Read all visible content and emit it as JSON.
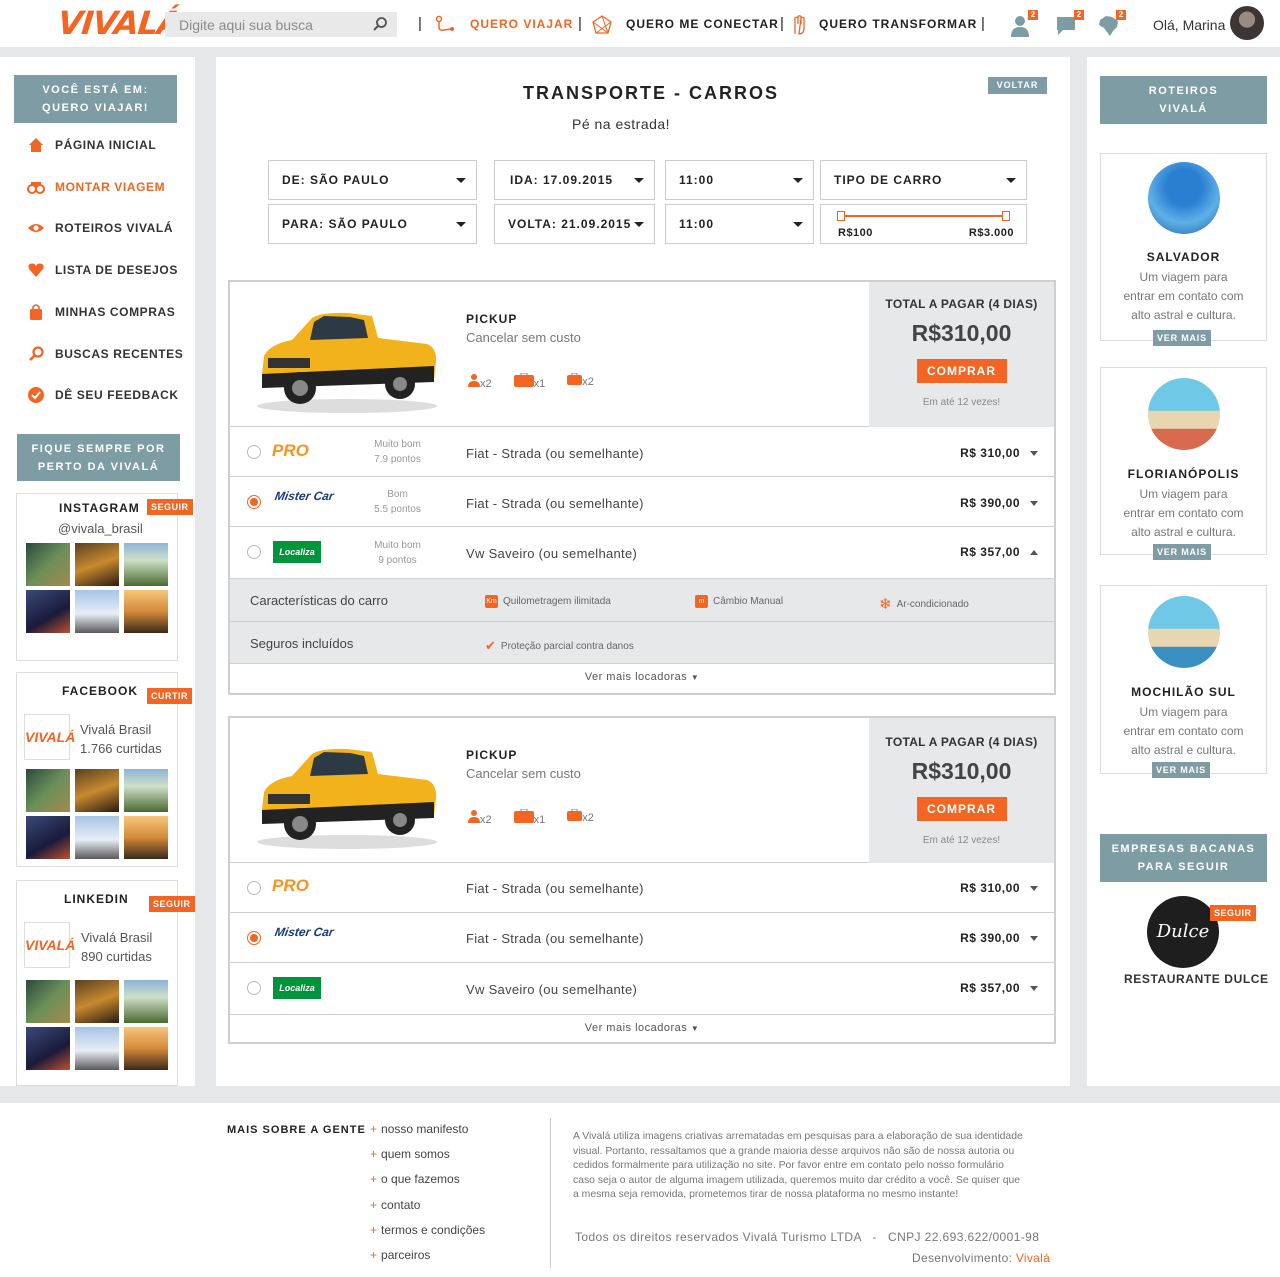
{
  "header": {
    "logo": "VIVALÁ",
    "search_placeholder": "Digite aqui sua busca",
    "nav": [
      "QUERO VIAJAR",
      "QUERO ME CONECTAR",
      "QUERO TRANSFORMAR"
    ],
    "badges": [
      "2",
      "2",
      "2"
    ],
    "greeting": "Olá, Marina"
  },
  "sidebar": {
    "you_are_in": "VOCÊ ESTÁ EM:",
    "you_are_in_sub": "QUERO VIAJAR!",
    "items": [
      {
        "label": "PÁGINA INICIAL",
        "icon": "home-icon"
      },
      {
        "label": "MONTAR VIAGEM",
        "icon": "binoculars-icon"
      },
      {
        "label": "ROTEIROS VIVALÁ",
        "icon": "eye-icon"
      },
      {
        "label": "LISTA DE DESEJOS",
        "icon": "heart-icon"
      },
      {
        "label": "MINHAS COMPRAS",
        "icon": "shopping-bag-icon"
      },
      {
        "label": "BUSCAS RECENTES",
        "icon": "magnifier-icon"
      },
      {
        "label": "DÊ SEU FEEDBACK",
        "icon": "check-icon"
      }
    ],
    "stay_close": "FIQUE SEMPRE POR",
    "stay_close_sub": "PERTO DA VIVALÁ",
    "instagram": {
      "title": "INSTAGRAM",
      "button": "SEGUIR",
      "handle": "@vivala_brasil"
    },
    "facebook": {
      "title": "FACEBOOK",
      "button": "CURTIR",
      "name": "Vivalá Brasil",
      "count": "1.766 curtidas"
    },
    "linkedin": {
      "title": "LINKEDIN",
      "button": "SEGUIR",
      "name": "Vivalá Brasil",
      "count": "890 curtidas"
    }
  },
  "main": {
    "title": "TRANSPORTE - CARROS",
    "subtitle": "Pé na estrada!",
    "back": "VOLTAR",
    "filters": {
      "from": "DE: SÃO PAULO",
      "to": "PARA: SÃO PAULO",
      "depart": "IDA: 17.09.2015",
      "return": "VOLTA: 21.09.2015",
      "time1": "11:00",
      "time2": "11:00",
      "car_type": "TIPO DE CARRO",
      "price_min": "R$100",
      "price_max": "R$3.000"
    },
    "cards": [
      {
        "type": "PICKUP",
        "cancel": "Cancelar sem custo",
        "pax": "x2",
        "bag_large": "x1",
        "bag_small": "x2",
        "total_label": "TOTAL A PAGAR (4 DIAS)",
        "total": "R$310,00",
        "buy": "COMPRAR",
        "installments": "Em até 12 vezes!",
        "rows": [
          {
            "company": "PRO",
            "rating": "Muito bom",
            "points": "7.9 pontos",
            "car": "Fiat - Strada (ou semelhante)",
            "price": "R$ 310,00"
          },
          {
            "company": "Mister Car",
            "rating": "Bom",
            "points": "5.5 pontos",
            "car": "Fiat - Strada (ou semelhante)",
            "price": "R$ 390,00"
          },
          {
            "company": "Localiza",
            "rating": "Muito bom",
            "points": "9 pontos",
            "car": "Vw Saveiro (ou semelhante)",
            "price": "R$ 357,00"
          }
        ],
        "features_label": "Características do carro",
        "features": [
          "Quilometragem ilimitada",
          "Câmbio Manual",
          "Ar-condicionado"
        ],
        "insurance_label": "Seguros incluídos",
        "insurance": "Proteção parcial contra danos",
        "more": "Ver mais locadoras"
      },
      {
        "type": "PICKUP",
        "cancel": "Cancelar sem custo",
        "pax": "x2",
        "bag_large": "x1",
        "bag_small": "x2",
        "total_label": "TOTAL A PAGAR (4 DIAS)",
        "total": "R$310,00",
        "buy": "COMPRAR",
        "installments": "Em até 12 vezes!",
        "rows": [
          {
            "company": "PRO",
            "car": "Fiat - Strada (ou semelhante)",
            "price": "R$ 310,00"
          },
          {
            "company": "Mister Car",
            "car": "Fiat - Strada (ou semelhante)",
            "price": "R$ 390,00"
          },
          {
            "company": "Localiza",
            "car": "Vw Saveiro (ou semelhante)",
            "price": "R$ 357,00"
          }
        ],
        "more": "Ver mais locadoras"
      }
    ]
  },
  "right": {
    "title": "ROTEIROS",
    "title_sub": "VIVALÁ",
    "cards": [
      {
        "name": "SALVADOR",
        "desc1": "Um viagem para",
        "desc2": "entrar em contato com",
        "desc3": "alto astral e cultura.",
        "more": "VER MAIS"
      },
      {
        "name": "FLORIANÓPOLIS",
        "desc1": "Um viagem para",
        "desc2": "entrar em contato com",
        "desc3": "alto astral e cultura.",
        "more": "VER MAIS"
      },
      {
        "name": "MOCHILÃO SUL",
        "desc1": "Um viagem para",
        "desc2": "entrar em contato com",
        "desc3": "alto astral e cultura.",
        "more": "VER MAIS"
      }
    ],
    "companies": "EMPRESAS BACANAS",
    "companies_sub": "PARA SEGUIR",
    "company_name": "RESTAURANTE DULCE",
    "company_logo": "Dulce",
    "follow": "SEGUIR"
  },
  "footer": {
    "heading": "MAIS SOBRE A GENTE",
    "links": [
      "nosso manifesto",
      "quem somos",
      "o que fazemos",
      "contato",
      "termos e condições",
      "parceiros"
    ],
    "notice1": "A Vivalá utiliza imagens criativas arrematadas em pesquisas para a elaboração de sua identidade",
    "notice2": "visual. Portanto, ressaltamos que a grande maioria desse arquivos não são de nossa autoria ou",
    "notice3": "cedidos formalmente para utilização no site. Por favor entre em contato pelo nosso formulário",
    "notice4": "caso seja o autor de alguma imagem utilizada, queremos muito dar crédito a você. Se quiser que",
    "notice5": "a mesma seja removida, prometemos tirar de nossa plataforma no mesmo instante!",
    "rights": "Todos os direitos reservados Vivalá Turismo LTDA   -   CNPJ 22.693.622/0001-98",
    "dev_label": "Desenvolvimento:",
    "dev_name": "Vivalá"
  },
  "colors": {
    "accent": "#f26522",
    "steel": "#7e9ca4",
    "gray": "#e6e7e8"
  }
}
